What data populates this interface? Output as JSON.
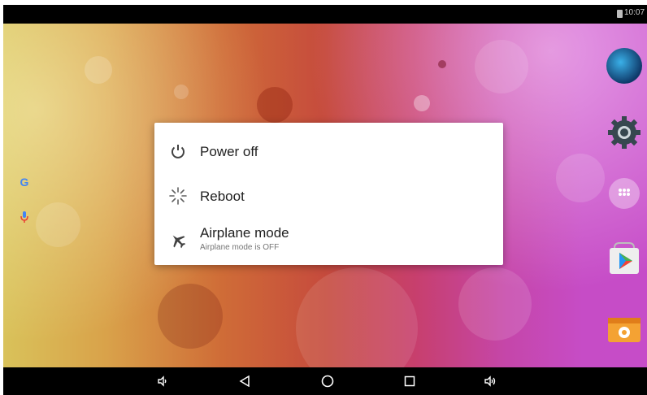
{
  "status_bar": {
    "time": "10:07"
  },
  "power_menu": {
    "items": [
      {
        "label": "Power off"
      },
      {
        "label": "Reboot"
      },
      {
        "label": "Airplane mode",
        "sublabel": "Airplane mode is OFF"
      }
    ]
  },
  "home_screen": {
    "left_widgets": [
      "google-search-icon",
      "voice-search-icon"
    ],
    "right_dock": [
      "browser-globe-icon",
      "settings-app-icon",
      "app-drawer-icon",
      "play-store-icon",
      "tools-app-icon"
    ]
  },
  "nav_bar": {
    "buttons": [
      "volume-down-icon",
      "back-icon",
      "home-icon",
      "recents-icon",
      "volume-up-icon"
    ]
  },
  "colors": {
    "dialog_bg": "#ffffff",
    "nav_bg": "#000000",
    "text_primary": "#212121",
    "text_secondary": "#757575"
  }
}
